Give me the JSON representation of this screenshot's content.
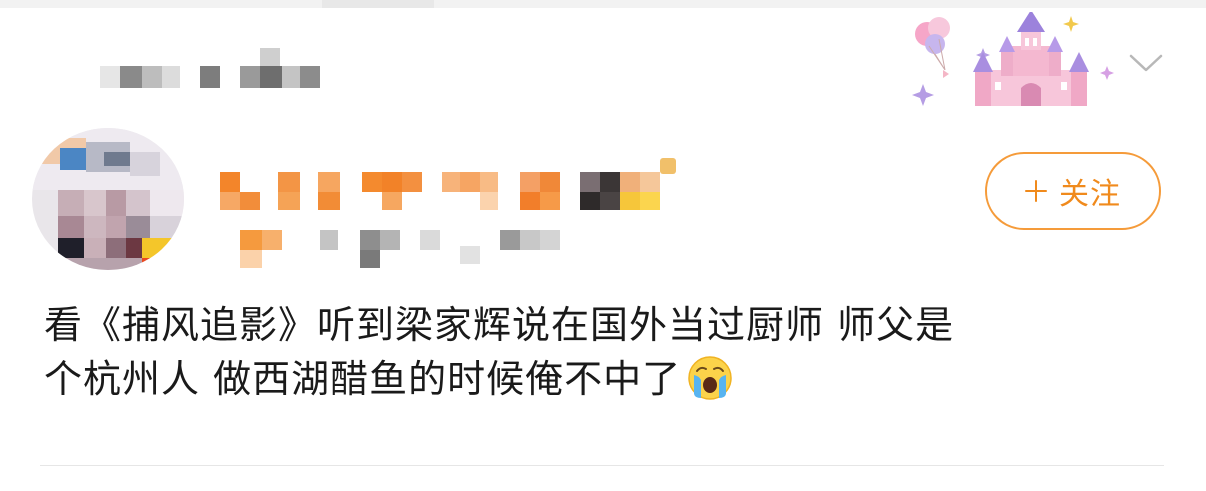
{
  "post": {
    "follow_label": "关注",
    "text_line1": "看《捕风追影》听到梁家辉说在国外当过厨师 师父是",
    "text_line2": "个杭州人 做西湖醋鱼的时候俺不中了"
  },
  "icons": {
    "collapse": "chevron-down-icon",
    "follow": "plus-icon",
    "emoji": "crying-face-emoji",
    "decoration": "castle-balloons-card-decoration"
  },
  "colors": {
    "accent": "#f08a1c",
    "follow_border": "#f59b3a",
    "text": "#1a1a1a",
    "divider": "#e6e6e6"
  }
}
